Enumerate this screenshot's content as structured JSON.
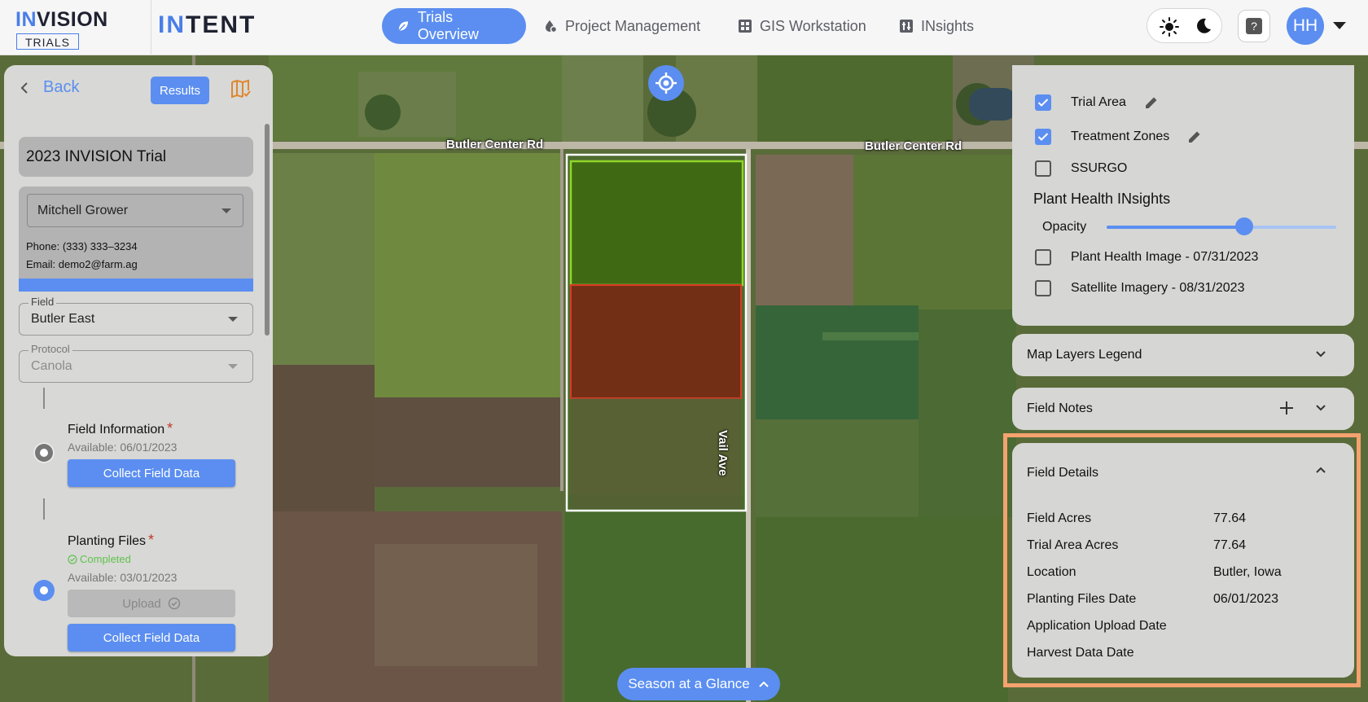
{
  "header": {
    "logo_invision_first": "IN",
    "logo_invision_rest": "VISION",
    "logo_trials": "TRIALS",
    "logo_intent_first": "IN",
    "logo_intent_rest": "TENT",
    "nav": [
      {
        "label": "Trials Overview",
        "icon": "leaf-icon",
        "active": true
      },
      {
        "label": "Project Management",
        "icon": "gear-drop-icon",
        "active": false
      },
      {
        "label": "GIS Workstation",
        "icon": "grid-icon",
        "active": false
      },
      {
        "label": "INsights",
        "icon": "sliders-icon",
        "active": false
      }
    ],
    "help_label": "?",
    "user_initials": "HH"
  },
  "map": {
    "road_labels": [
      "Butler Center Rd",
      "Butler Center Rd",
      "Vail Ave"
    ],
    "season_button": "Season at a Glance"
  },
  "left_panel": {
    "back_label": "Back",
    "results_label": "Results",
    "trial_name": "2023 INVISION Trial",
    "grower": {
      "name": "Mitchell Grower",
      "phone": "Phone: (333) 333–3234",
      "email": "Email: demo2@farm.ag"
    },
    "field": {
      "label": "Field",
      "value": "Butler East"
    },
    "protocol": {
      "label": "Protocol",
      "value": "Canola"
    },
    "steps": [
      {
        "title": "Field Information",
        "required": "*",
        "available": "Available: 06/01/2023",
        "button": "Collect Field Data"
      },
      {
        "title": "Planting Files",
        "required": "*",
        "status": "Completed",
        "available": "Available: 03/01/2023",
        "upload": "Upload",
        "button": "Collect Field Data"
      }
    ]
  },
  "layers": {
    "items": [
      {
        "label": "Trial Area",
        "checked": true
      },
      {
        "label": "Treatment Zones",
        "checked": true
      },
      {
        "label": "SSURGO",
        "checked": false
      }
    ],
    "plant_health_title": "Plant Health INsights",
    "opacity_label": "Opacity",
    "opacity_value": 0.6,
    "imagery": [
      {
        "label": "Plant Health Image - 07/31/2023",
        "checked": false
      },
      {
        "label": "Satellite Imagery - 08/31/2023",
        "checked": false
      }
    ]
  },
  "panels": {
    "legend_title": "Map Layers Legend",
    "notes_title": "Field Notes"
  },
  "field_details": {
    "title": "Field Details",
    "rows": [
      {
        "label": "Field Acres",
        "value": "77.64"
      },
      {
        "label": "Trial Area Acres",
        "value": "77.64"
      },
      {
        "label": "Location",
        "value": "Butler, Iowa"
      },
      {
        "label": "Planting Files Date",
        "value": "06/01/2023"
      },
      {
        "label": "Application Upload Date",
        "value": ""
      },
      {
        "label": "Harvest Data Date",
        "value": ""
      }
    ]
  },
  "colors": {
    "accent": "#5b8ef0",
    "completed": "#5fc24e",
    "highlight": "#f5a26f",
    "zone_green": "#8fd62a",
    "zone_red": "#d93a25"
  }
}
